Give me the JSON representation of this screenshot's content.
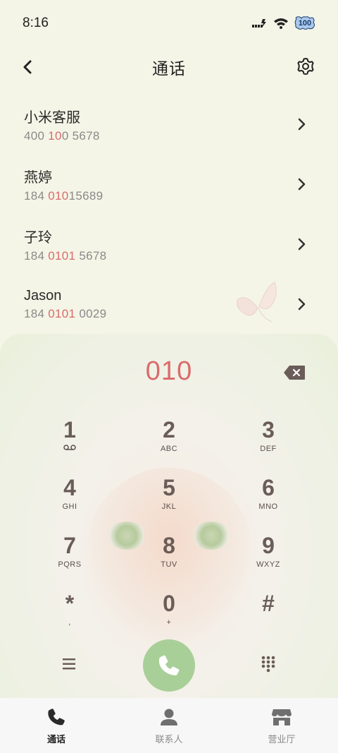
{
  "status_bar": {
    "time": "8:16",
    "battery": "100"
  },
  "header": {
    "title": "通话"
  },
  "results": [
    {
      "name": "小米客服",
      "number_parts": [
        "400 ",
        "10",
        "0",
        " 5678"
      ],
      "hl": [
        false,
        true,
        false,
        false
      ]
    },
    {
      "name": "燕婷",
      "number_parts": [
        "184 ",
        "010",
        "15689"
      ],
      "hl": [
        false,
        true,
        false
      ]
    },
    {
      "name": "子玲",
      "number_parts": [
        "184 ",
        "0101",
        " 5678"
      ],
      "hl": [
        false,
        true,
        false
      ]
    },
    {
      "name": "Jason",
      "number_parts": [
        "184 ",
        "0101",
        " 0029"
      ],
      "hl": [
        false,
        true,
        false
      ]
    }
  ],
  "dialer": {
    "input": "010",
    "keys": [
      {
        "digit": "1",
        "letters": ""
      },
      {
        "digit": "2",
        "letters": "ABC"
      },
      {
        "digit": "3",
        "letters": "DEF"
      },
      {
        "digit": "4",
        "letters": "GHI"
      },
      {
        "digit": "5",
        "letters": "JKL"
      },
      {
        "digit": "6",
        "letters": "MNO"
      },
      {
        "digit": "7",
        "letters": "PQRS"
      },
      {
        "digit": "8",
        "letters": "TUV"
      },
      {
        "digit": "9",
        "letters": "WXYZ"
      },
      {
        "digit": "*",
        "letters": ","
      },
      {
        "digit": "0",
        "letters": "+"
      },
      {
        "digit": "#",
        "letters": ""
      }
    ]
  },
  "bottom_nav": {
    "items": [
      {
        "label": "通话",
        "icon": "phone-icon",
        "active": true
      },
      {
        "label": "联系人",
        "icon": "person-icon",
        "active": false
      },
      {
        "label": "营业厅",
        "icon": "store-icon",
        "active": false
      }
    ]
  },
  "colors": {
    "highlight": "#d96b6b",
    "call_button": "#a9cf98",
    "background": "#f4f5e6"
  }
}
